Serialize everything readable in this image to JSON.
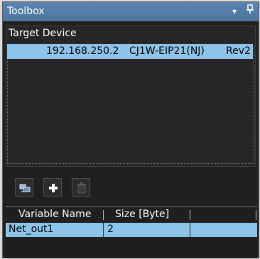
{
  "window": {
    "title": "Toolbox",
    "dropdown_glyph": "▾",
    "pin_glyph": "ᵼ"
  },
  "device_panel": {
    "header": "Target Device",
    "selected_row": {
      "address": "192.168.250.2",
      "model": "CJ1W-EIP21(NJ)",
      "revision": "Rev2"
    }
  },
  "toolbar": {
    "buttons": [
      {
        "icon": "device-list-icon",
        "enabled": true
      },
      {
        "icon": "plus-icon",
        "enabled": true
      },
      {
        "icon": "trash-icon",
        "enabled": false
      }
    ]
  },
  "variable_table": {
    "columns": [
      "Variable Name",
      "Size [Byte]",
      ""
    ],
    "rows": [
      {
        "name": "Net_out1",
        "size": "2",
        "extra": ""
      }
    ]
  },
  "colors": {
    "title_bar": "#5278a2",
    "selection": "#8ec3ea",
    "panel_bg": "#202020"
  }
}
